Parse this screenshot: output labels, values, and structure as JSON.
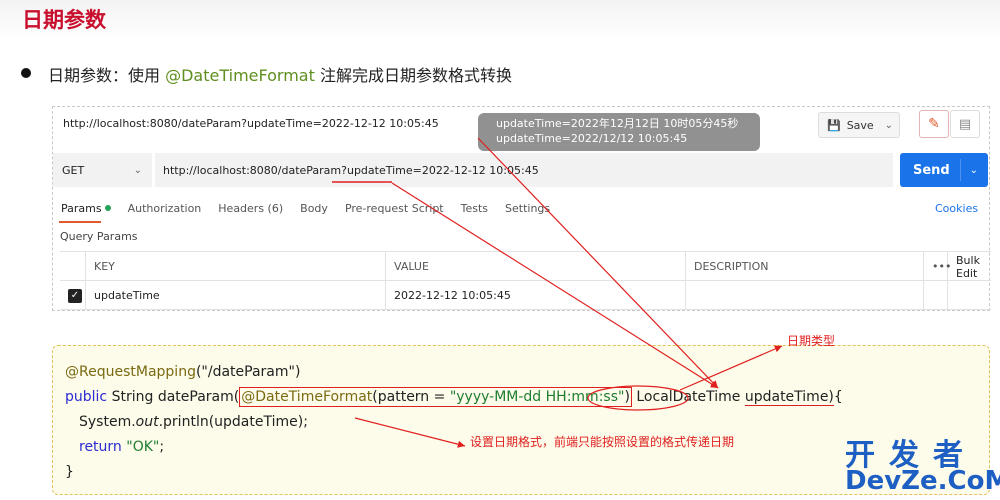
{
  "slide": {
    "title": "日期参数",
    "bullet_prefix": "日期参数：使用 ",
    "bullet_annotation": "@DateTimeFormat",
    "bullet_suffix": " 注解完成日期参数格式转换"
  },
  "request": {
    "title_url": "http://localhost:8080/dateParam?updateTime=2022-12-12 10:05:45",
    "save_label": "Save",
    "method": "GET",
    "url": "http://localhost:8080/dateParam?updateTime=2022-12-12 10:05:45",
    "send_label": "Send",
    "tabs": [
      "Params",
      "Authorization",
      "Headers (6)",
      "Body",
      "Pre-request Script",
      "Tests",
      "Settings"
    ],
    "cookies_label": "Cookies",
    "query_params_title": "Query Params",
    "columns": [
      "KEY",
      "VALUE",
      "DESCRIPTION",
      "•••",
      "Bulk Edit"
    ],
    "params": [
      {
        "key": "updateTime",
        "value": "2022-12-12 10:05:45",
        "description": "",
        "checked": true
      }
    ]
  },
  "tooltip": {
    "line1": "updateTime=2022年12月12日 10时05分45秒",
    "line2": "updateTime=2022/12/12 10:05:45"
  },
  "code": {
    "line1_annotation": "@RequestMapping",
    "line1_arg": "(\"/dateParam\")",
    "line2_kw": "public",
    "line2_type": " String ",
    "line2_method": "dateParam(",
    "line2_annotation": "@DateTimeFormat",
    "line2_pattern_open": "(pattern = ",
    "line2_pattern_str": "\"yyyy-MM-dd HH:mm:ss\"",
    "line2_pattern_close": ")",
    "line2_paramtype": "LocalDateTime",
    "line2_param": "updateTime)",
    "line2_tail": "{",
    "line3_pre": "System.",
    "line3_out": "out",
    "line3_post": ".println(updateTime);",
    "line4_kw": "return",
    "line4_str": " \"OK\"",
    "line4_end": ";",
    "line5": "}"
  },
  "annotations": {
    "date_type": "日期类型",
    "date_format": "设置日期格式，前端只能按照设置的格式传递日期"
  },
  "watermark": {
    "cn": "开发者",
    "en": "DevZe.CoM"
  },
  "colors": {
    "title_red": "#c8102e",
    "send_blue": "#1a73e8",
    "annotation_red": "#e02020"
  }
}
